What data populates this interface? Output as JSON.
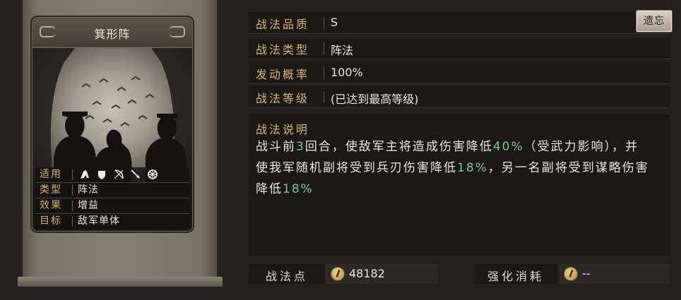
{
  "card": {
    "title": "箕形阵",
    "attributes": [
      {
        "key": "适用",
        "value": ""
      },
      {
        "key": "类型",
        "value": "阵法"
      },
      {
        "key": "效果",
        "value": "增益"
      },
      {
        "key": "目标",
        "value": "敌军单体"
      }
    ],
    "applicable_icons": [
      "cavalry-icon",
      "shield-icon",
      "bow-icon",
      "spear-icon",
      "wheel-icon"
    ]
  },
  "info": {
    "quality": {
      "label": "战法品质",
      "value": "S"
    },
    "type": {
      "label": "战法类型",
      "value": "阵法"
    },
    "rate": {
      "label": "发动概率",
      "value": "100%"
    },
    "level": {
      "label": "战法等级",
      "value": "(已达到最高等级)"
    },
    "description": {
      "label": "战法说明",
      "parts": {
        "p1": "战斗前",
        "n1": "3",
        "p2": "回合，使敌军主将造成伤害降低",
        "n2": "40%",
        "p3": "（受武力影响），并使我军随机副将受到兵刃伤害降低",
        "n3": "18%",
        "p4": "，另一名副将受到谋略伤害降低",
        "n4": "18%"
      }
    }
  },
  "buttons": {
    "reset": "遗忘"
  },
  "bottom": {
    "points_label": "战法点",
    "points_value": "48182",
    "cost_label": "强化消耗",
    "cost_value": "--"
  },
  "colors": {
    "accent_gold": "#d9b56d",
    "highlight_green": "#85c08c",
    "panel_bg": "#1a1918"
  }
}
